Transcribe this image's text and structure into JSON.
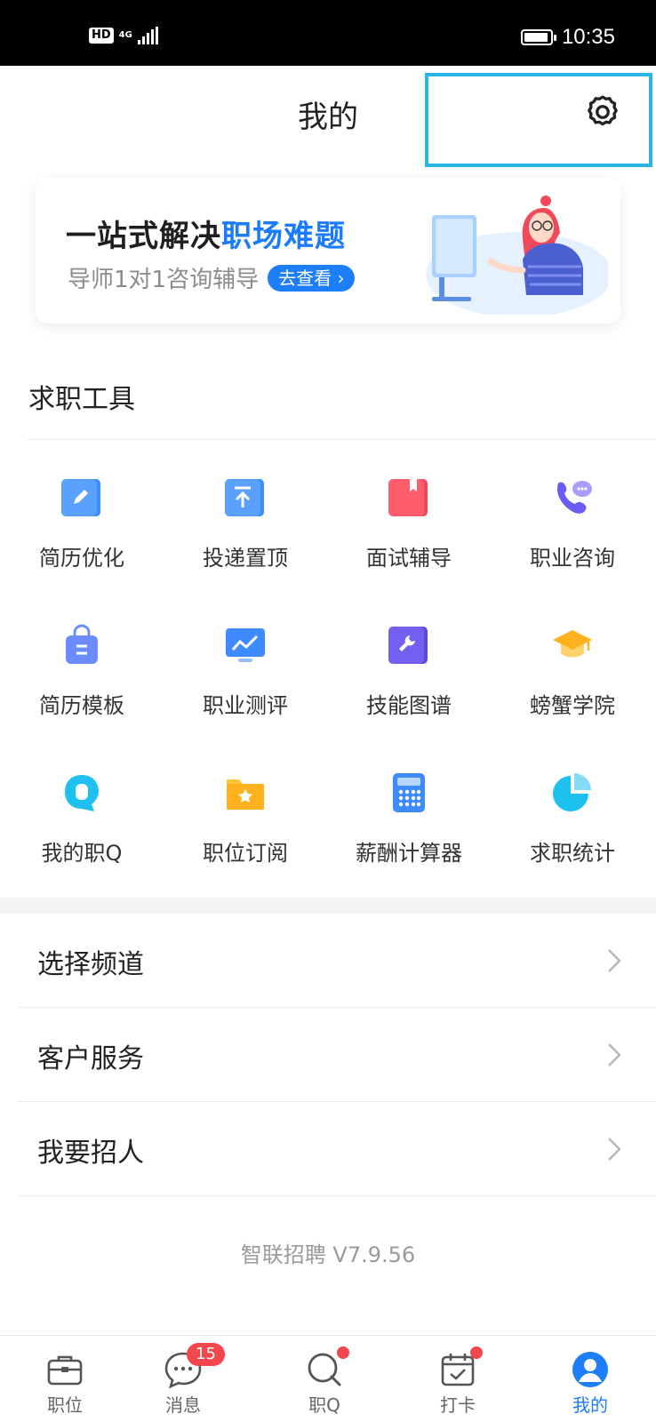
{
  "status_bar": {
    "hd": "HD",
    "network": "4G",
    "time": "10:35"
  },
  "header": {
    "title": "我的"
  },
  "banner": {
    "title_part1": "一站式解决",
    "title_part2": "职场难题",
    "subtitle": "导师1对1咨询辅导",
    "cta": "去查看"
  },
  "tools_section": {
    "title": "求职工具",
    "items": [
      {
        "label": "简历优化",
        "icon": "edit-icon"
      },
      {
        "label": "投递置顶",
        "icon": "pin-top-icon"
      },
      {
        "label": "面试辅导",
        "icon": "bookmark-book-icon"
      },
      {
        "label": "职业咨询",
        "icon": "phone-chat-icon"
      },
      {
        "label": "简历模板",
        "icon": "shopping-bag-icon"
      },
      {
        "label": "职业测评",
        "icon": "monitor-chart-icon"
      },
      {
        "label": "技能图谱",
        "icon": "wrench-icon"
      },
      {
        "label": "螃蟹学院",
        "icon": "graduation-cap-icon"
      },
      {
        "label": "我的职Q",
        "icon": "q-bubble-icon"
      },
      {
        "label": "职位订阅",
        "icon": "folder-star-icon"
      },
      {
        "label": "薪酬计算器",
        "icon": "calculator-icon"
      },
      {
        "label": "求职统计",
        "icon": "pie-chart-icon"
      }
    ]
  },
  "menu": [
    {
      "label": "选择频道"
    },
    {
      "label": "客户服务"
    },
    {
      "label": "我要招人"
    }
  ],
  "version": "智联招聘 V7.9.56",
  "tabbar": {
    "tabs": [
      {
        "label": "职位",
        "icon": "briefcase-icon"
      },
      {
        "label": "消息",
        "icon": "chat-bubble-icon",
        "badge": "15"
      },
      {
        "label": "职Q",
        "icon": "q-search-icon"
      },
      {
        "label": "打卡",
        "icon": "calendar-check-icon"
      },
      {
        "label": "我的",
        "icon": "user-avatar-icon"
      }
    ]
  },
  "colors": {
    "accent": "#1e7ef8",
    "badge": "#f2474d",
    "highlight_border": "#29b6e6"
  }
}
